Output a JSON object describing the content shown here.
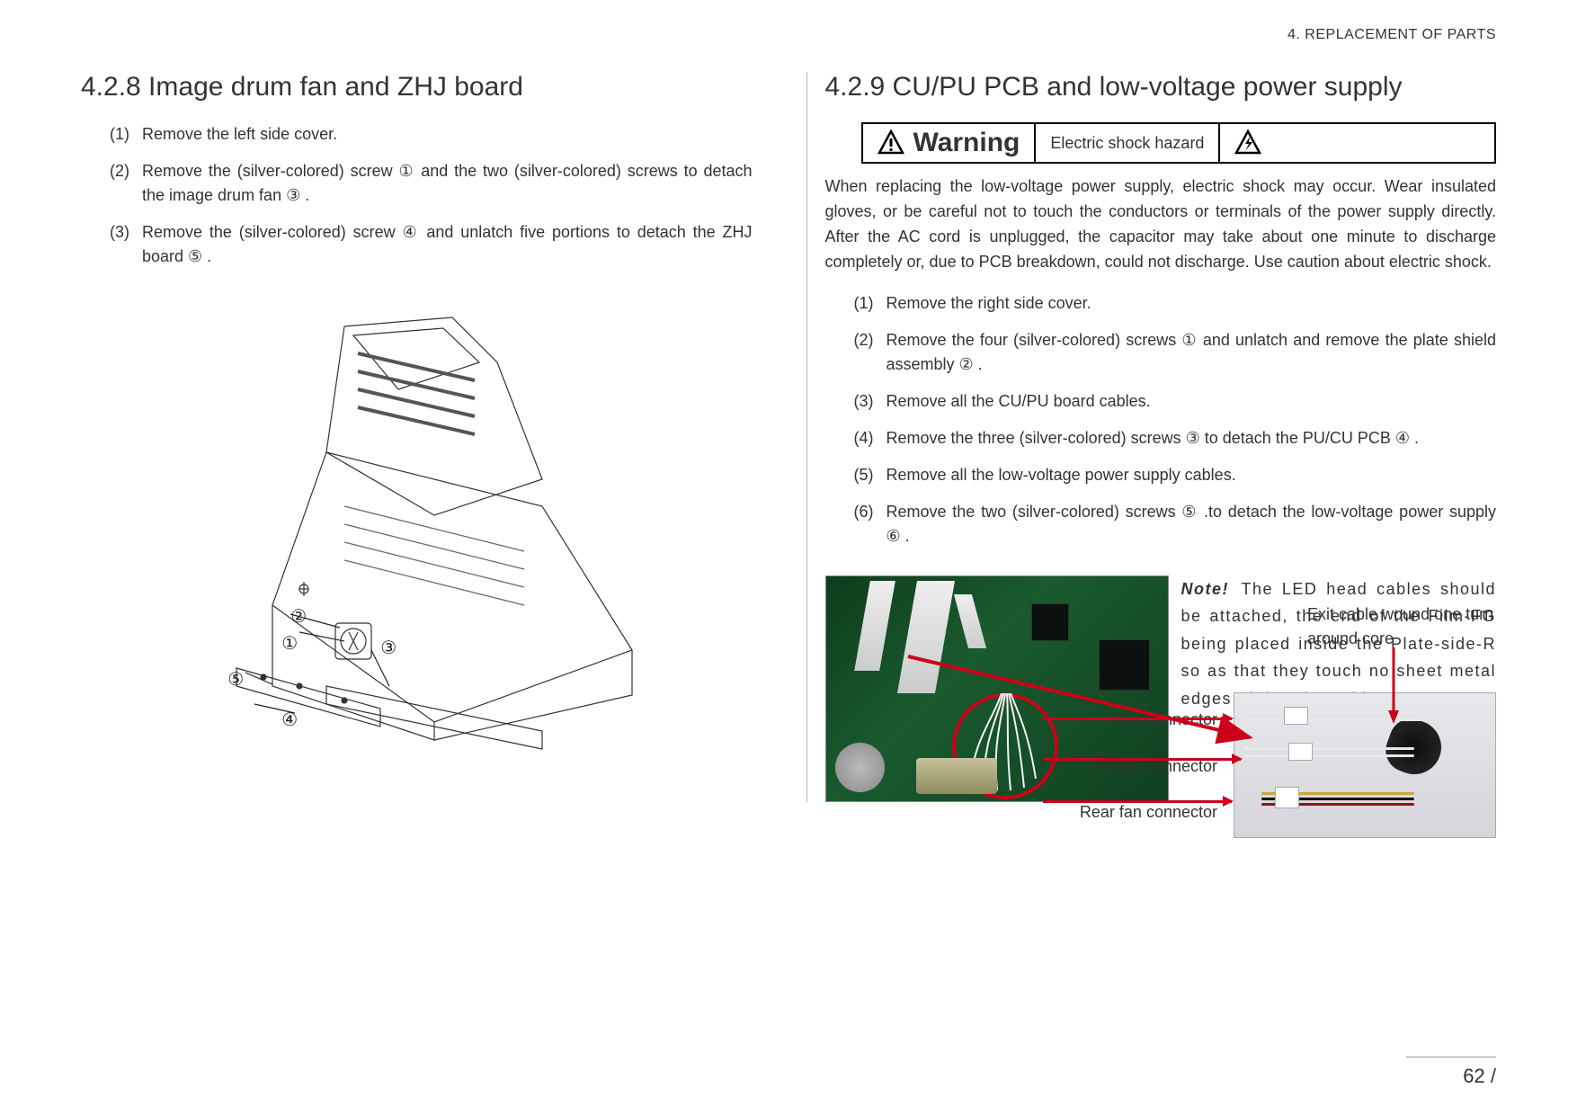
{
  "header": {
    "chapter_tag": "4.  REPLACEMENT OF PARTS"
  },
  "left": {
    "heading": "4.2.8 Image drum fan and ZHJ board",
    "steps": [
      "Remove the left side cover.",
      "Remove the (silver-colored) screw  ① and the two (silver-colored) screws to detach the image drum fan  ③ .",
      "Remove the (silver-colored) screw  ④ and unlatch five portions to detach the ZHJ board  ⑤ ."
    ],
    "callouts": [
      "①",
      "②",
      "③",
      "④",
      "⑤"
    ]
  },
  "right": {
    "heading": "4.2.9 CU/PU PCB and low-voltage power supply",
    "warning": {
      "label": "Warning",
      "hazard": "Electric shock hazard"
    },
    "warning_text": "When replacing the low-voltage power supply, electric shock may occur. Wear insulated gloves, or be careful not to touch the conductors or terminals of the power supply directly. After the AC cord is unplugged, the capacitor may take about one minute to discharge completely or, due to PCB breakdown, could not discharge. Use caution about electric shock.",
    "steps": [
      "Remove the right side cover.",
      "Remove the four (silver-colored) screws ① and unlatch and remove the plate shield assembly ② .",
      "Remove all the CU/PU board cables.",
      "Remove the three (silver-colored) screws  ③ to detach the PU/CU PCB  ④ .",
      "Remove all the low-voltage power supply cables.",
      "Remove the two (silver-colored) screws  ⑤ .to detach the low-voltage power supply ⑥ ."
    ],
    "note_label": "Note!",
    "note_text": "The LED head cables should be attached, the end of the Film-FG being placed inside the Plate-side-R so as that they touch no sheet metal edges of the Plate-side-R.",
    "exit_note": "Exit cable wound one turn around core",
    "connector_labels": {
      "exit": "Exit connector",
      "fuser": "Fuser connector",
      "rear_fan": "Rear fan connector"
    }
  },
  "page_number": "62 /"
}
